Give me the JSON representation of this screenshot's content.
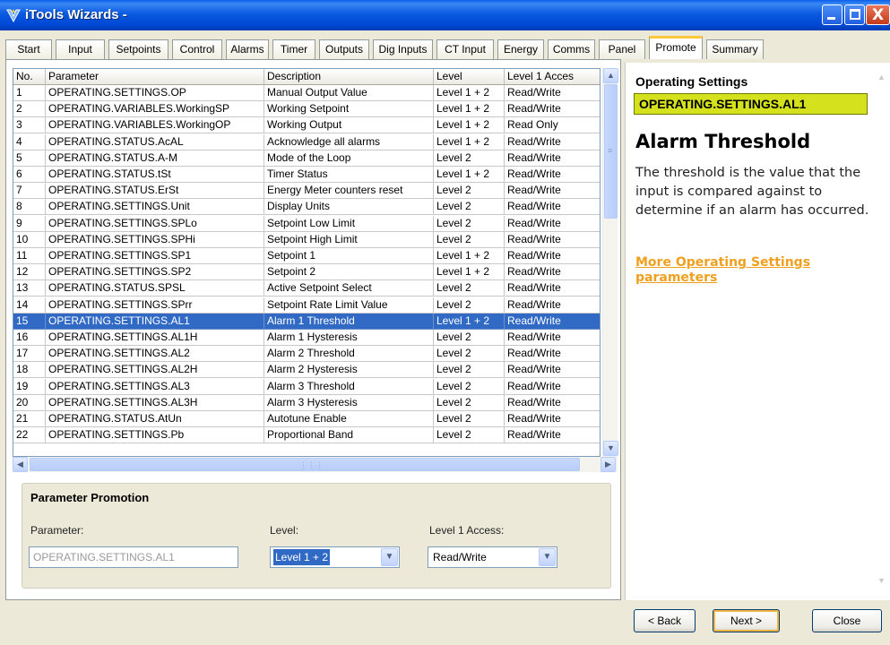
{
  "window": {
    "title": "iTools Wizards -",
    "icon": "wizard-icon",
    "controls": {
      "minimize": "minimize-icon",
      "maximize": "maximize-icon",
      "close": "close-icon",
      "close_glyph": "X"
    }
  },
  "tabs": [
    "Start",
    "Input",
    "Setpoints",
    "Control",
    "Alarms",
    "Timer",
    "Outputs",
    "Dig Inputs",
    "CT Input",
    "Energy",
    "Comms",
    "Panel",
    "Promote",
    "Summary"
  ],
  "active_tab": "Promote",
  "grid": {
    "columns": [
      "No.",
      "Parameter",
      "Description",
      "Level",
      "Level 1 Acces"
    ],
    "rows": [
      [
        "1",
        "OPERATING.SETTINGS.OP",
        "Manual Output Value",
        "Level 1 + 2",
        "Read/Write"
      ],
      [
        "2",
        "OPERATING.VARIABLES.WorkingSP",
        "Working Setpoint",
        "Level 1 + 2",
        "Read/Write"
      ],
      [
        "3",
        "OPERATING.VARIABLES.WorkingOP",
        "Working Output",
        "Level 1 + 2",
        "Read Only"
      ],
      [
        "4",
        "OPERATING.STATUS.AcAL",
        "Acknowledge all alarms",
        "Level 1 + 2",
        "Read/Write"
      ],
      [
        "5",
        "OPERATING.STATUS.A-M",
        "Mode of the Loop",
        "Level 2",
        "Read/Write"
      ],
      [
        "6",
        "OPERATING.STATUS.tSt",
        "Timer Status",
        "Level 1 + 2",
        "Read/Write"
      ],
      [
        "7",
        "OPERATING.STATUS.ErSt",
        "Energy Meter counters reset",
        "Level 2",
        "Read/Write"
      ],
      [
        "8",
        "OPERATING.SETTINGS.Unit",
        "Display Units",
        "Level 2",
        "Read/Write"
      ],
      [
        "9",
        "OPERATING.SETTINGS.SPLo",
        "Setpoint Low Limit",
        "Level 2",
        "Read/Write"
      ],
      [
        "10",
        "OPERATING.SETTINGS.SPHi",
        "Setpoint High Limit",
        "Level 2",
        "Read/Write"
      ],
      [
        "11",
        "OPERATING.SETTINGS.SP1",
        "Setpoint 1",
        "Level 1 + 2",
        "Read/Write"
      ],
      [
        "12",
        "OPERATING.SETTINGS.SP2",
        "Setpoint 2",
        "Level 1 + 2",
        "Read/Write"
      ],
      [
        "13",
        "OPERATING.STATUS.SPSL",
        "Active Setpoint Select",
        "Level 2",
        "Read/Write"
      ],
      [
        "14",
        "OPERATING.SETTINGS.SPrr",
        "Setpoint Rate Limit Value",
        "Level 2",
        "Read/Write"
      ],
      [
        "15",
        "OPERATING.SETTINGS.AL1",
        "Alarm 1 Threshold",
        "Level 1 + 2",
        "Read/Write"
      ],
      [
        "16",
        "OPERATING.SETTINGS.AL1H",
        "Alarm 1 Hysteresis",
        "Level 2",
        "Read/Write"
      ],
      [
        "17",
        "OPERATING.SETTINGS.AL2",
        "Alarm 2 Threshold",
        "Level 2",
        "Read/Write"
      ],
      [
        "18",
        "OPERATING.SETTINGS.AL2H",
        "Alarm 2 Hysteresis",
        "Level 2",
        "Read/Write"
      ],
      [
        "19",
        "OPERATING.SETTINGS.AL3",
        "Alarm 3 Threshold",
        "Level 2",
        "Read/Write"
      ],
      [
        "20",
        "OPERATING.SETTINGS.AL3H",
        "Alarm 3 Hysteresis",
        "Level 2",
        "Read/Write"
      ],
      [
        "21",
        "OPERATING.STATUS.AtUn",
        "Autotune Enable",
        "Level 2",
        "Read/Write"
      ],
      [
        "22",
        "OPERATING.SETTINGS.Pb",
        "Proportional Band",
        "Level 2",
        "Read/Write"
      ]
    ],
    "selected_row": 15
  },
  "promotion": {
    "title": "Parameter Promotion",
    "parameter_label": "Parameter:",
    "parameter_value": "OPERATING.SETTINGS.AL1",
    "level_label": "Level:",
    "level_value": "Level 1 + 2",
    "access_label": "Level 1 Access:",
    "access_value": "Read/Write"
  },
  "help": {
    "section": "Operating Settings",
    "parameter": "OPERATING.SETTINGS.AL1",
    "title": "Alarm Threshold",
    "body": "The threshold is the value that the input is compared against to determine if an alarm has occurred.",
    "link": "More Operating Settings parameters"
  },
  "buttons": {
    "back": "< Back",
    "next": "Next >",
    "close": "Close"
  },
  "colors": {
    "selection": "#316AC5",
    "highlight_param": "#D4E11C",
    "link": "#F0A020",
    "titlebar": "#0054E3"
  }
}
